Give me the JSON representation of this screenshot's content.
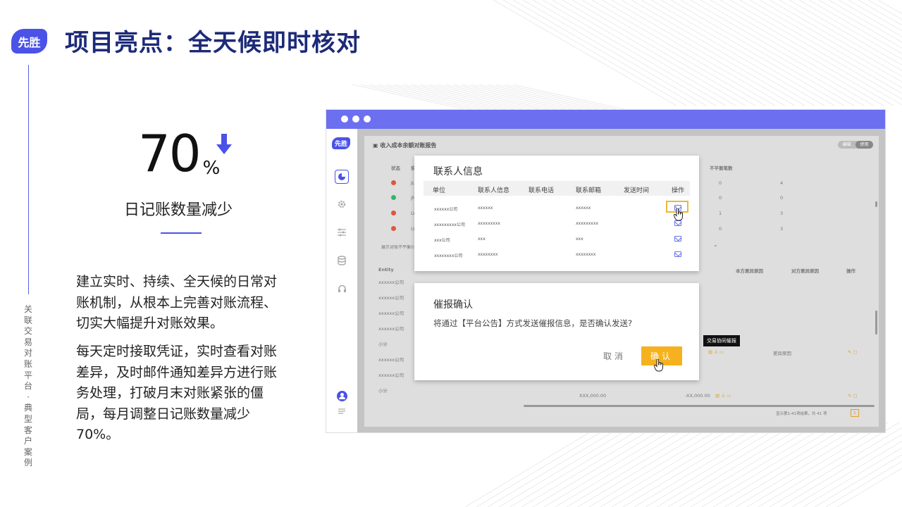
{
  "brand": {
    "logo_text": "先胜"
  },
  "header": {
    "title": "项目亮点：全天候即时核对"
  },
  "sidebar_caption": "关联交易对账平台·典型客户案例",
  "stat": {
    "value": "70",
    "unit": "%",
    "label": "日记账数量减少",
    "trend_icon": "arrow-down-icon"
  },
  "paragraphs": [
    "建立实时、持续、全天候的日常对账机制，从根本上完善对账流程、切实大幅提升对账效果。",
    "每天定时接取凭证，实时查看对账差异，及时邮件通知差异方进行账务处理，打破月末对账紧张的僵局，每月调整日记账数量减少70%。"
  ],
  "colors": {
    "accent": "#4a52e8",
    "title": "#1c2a78",
    "window_bar": "#6c6ff0",
    "confirm": "#f5b21e"
  },
  "screenshot": {
    "logo_text": "先胜",
    "page_title": "收入成本余额对账报告",
    "toggle": [
      "编辑",
      "使用"
    ],
    "bg": {
      "col_status": "状态",
      "col_entity_short": "实体",
      "col_unbalanced": "不平衡笔数",
      "row_codes": [
        "JLI-",
        "JM-",
        "LY-",
        "LY-"
      ],
      "row_zero": [
        "0",
        "0",
        "1",
        "0"
      ],
      "row_counts": [
        "4",
        "0",
        "3",
        "3"
      ],
      "status_colors": [
        "#e2553b",
        "#3bb36b",
        "#e2553b",
        "#e2553b"
      ],
      "summary": "展示对账不平衡0条",
      "entity_header": "Entity",
      "own_reason": "本方差异原因",
      "other_reason": "对方差异原因",
      "action": "操作",
      "entity_rows": [
        "xxxxxx公司",
        "xxxxxx公司",
        "xxxxxx公司",
        "xxxxxx公司",
        "小计",
        "xxxxxx公司",
        "xxxxxx公司",
        "小计"
      ],
      "diff_reason": "差异原因",
      "amount_left": "XXX,000.00",
      "amount_right": "-XX,000.00",
      "pagination": "显示第1-41项结果，共 41 项",
      "page_no": "1"
    },
    "contact_modal": {
      "title": "联系人信息",
      "headers": [
        "单位",
        "联系人信息",
        "联系电话",
        "联系邮箱",
        "发送时间",
        "操作"
      ],
      "rows": [
        {
          "unit": "xxxxxx公司",
          "contact": "xxxxxx",
          "email": "xxxxxx"
        },
        {
          "unit": "xxxxxxxxx公司",
          "contact": "xxxxxxxxx",
          "email": "xxxxxxxxx"
        },
        {
          "unit": "xxx公司",
          "contact": "xxx",
          "email": "xxx"
        },
        {
          "unit": "xxxxxxxx公司",
          "contact": "xxxxxxxx",
          "email": "xxxxxxxx"
        }
      ]
    },
    "confirm_modal": {
      "title": "催报确认",
      "message": "将通过【平台公告】方式发送催报信息，是否确认发送?",
      "cancel": "取消",
      "confirm": "确认"
    },
    "tooltip": "交易协同催报"
  }
}
